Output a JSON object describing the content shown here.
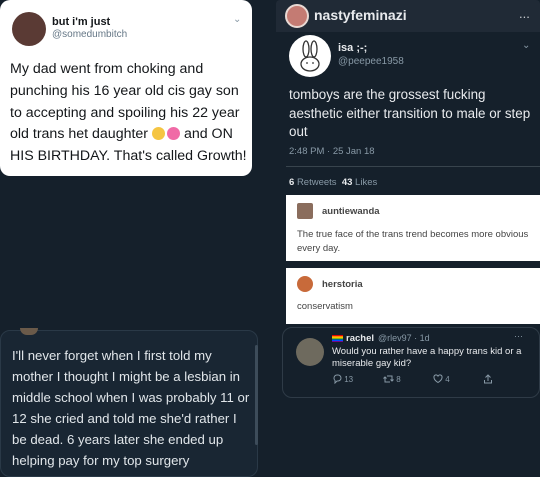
{
  "tweet_white": {
    "name": "but i'm just",
    "handle": "@somedumbitch",
    "text_part1": "My dad went from choking and punching his 16 year old cis gay son to accepting and spoiling his 22 year old trans het daughter",
    "text_part2": "and ON HIS BIRTHDAY. That's called Growth!",
    "emojis": [
      "crying-laughing-emoji",
      "sparkling-heart-emoji"
    ]
  },
  "tumblr": {
    "username": "nastyfeminazi",
    "menu": "...",
    "tweet": {
      "name": "isa ;-;",
      "handle": "@peepee1958",
      "text": "tomboys are the grossest fucking aesthetic either transition to male or step out",
      "time": "2:48 PM · 25 Jan 18",
      "retweets_count": "6",
      "retweets_label": "Retweets",
      "likes_count": "43",
      "likes_label": "Likes"
    },
    "comments": [
      {
        "name": "auntiewanda",
        "text": "The true face of the trans trend becomes more obvious every day."
      },
      {
        "name": "herstoria",
        "text": "conservatism"
      }
    ]
  },
  "dark_block": {
    "text": "I'll never forget when I first told my mother I thought I might be a lesbian in middle school when I was probably 11 or 12 she cried and told me she'd rather I be dead. 6 years later she ended up helping pay for my top surgery"
  },
  "rachel_tweet": {
    "name": "rachel",
    "meta": "@rlev97 · 1d",
    "menu": "···",
    "text": "Would you rather have a happy trans kid or a miserable gay kid?",
    "replies": "13",
    "retweets": "8",
    "likes": "4"
  }
}
